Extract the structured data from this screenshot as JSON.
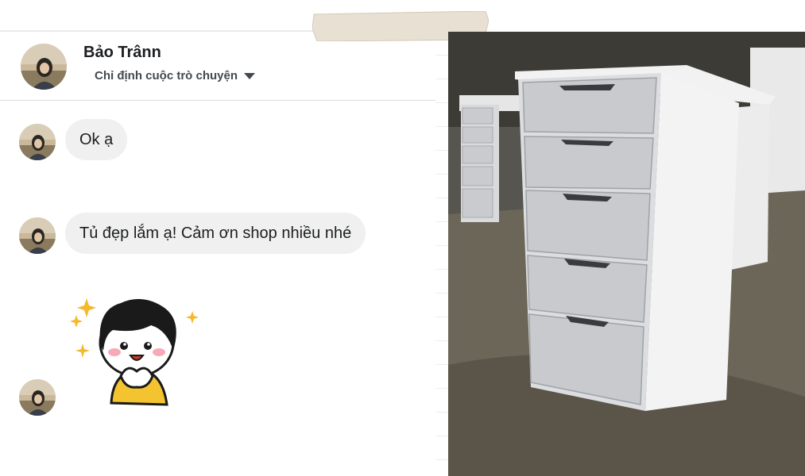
{
  "conversation": {
    "contact_name": "Bảo Trânn",
    "assign_label": "Chỉ định cuộc trò chuyện",
    "messages": [
      {
        "text": "Ok ạ"
      },
      {
        "text": "Tủ đẹp lắm ạ! Cảm ơn shop nhiều nhé"
      }
    ],
    "sticker": "girl-sticker"
  },
  "photo": {
    "subject": "white-drawer-cabinet"
  },
  "colors": {
    "bubble": "#f0f0f0",
    "text": "#1c1e21",
    "secondary": "#444950"
  }
}
